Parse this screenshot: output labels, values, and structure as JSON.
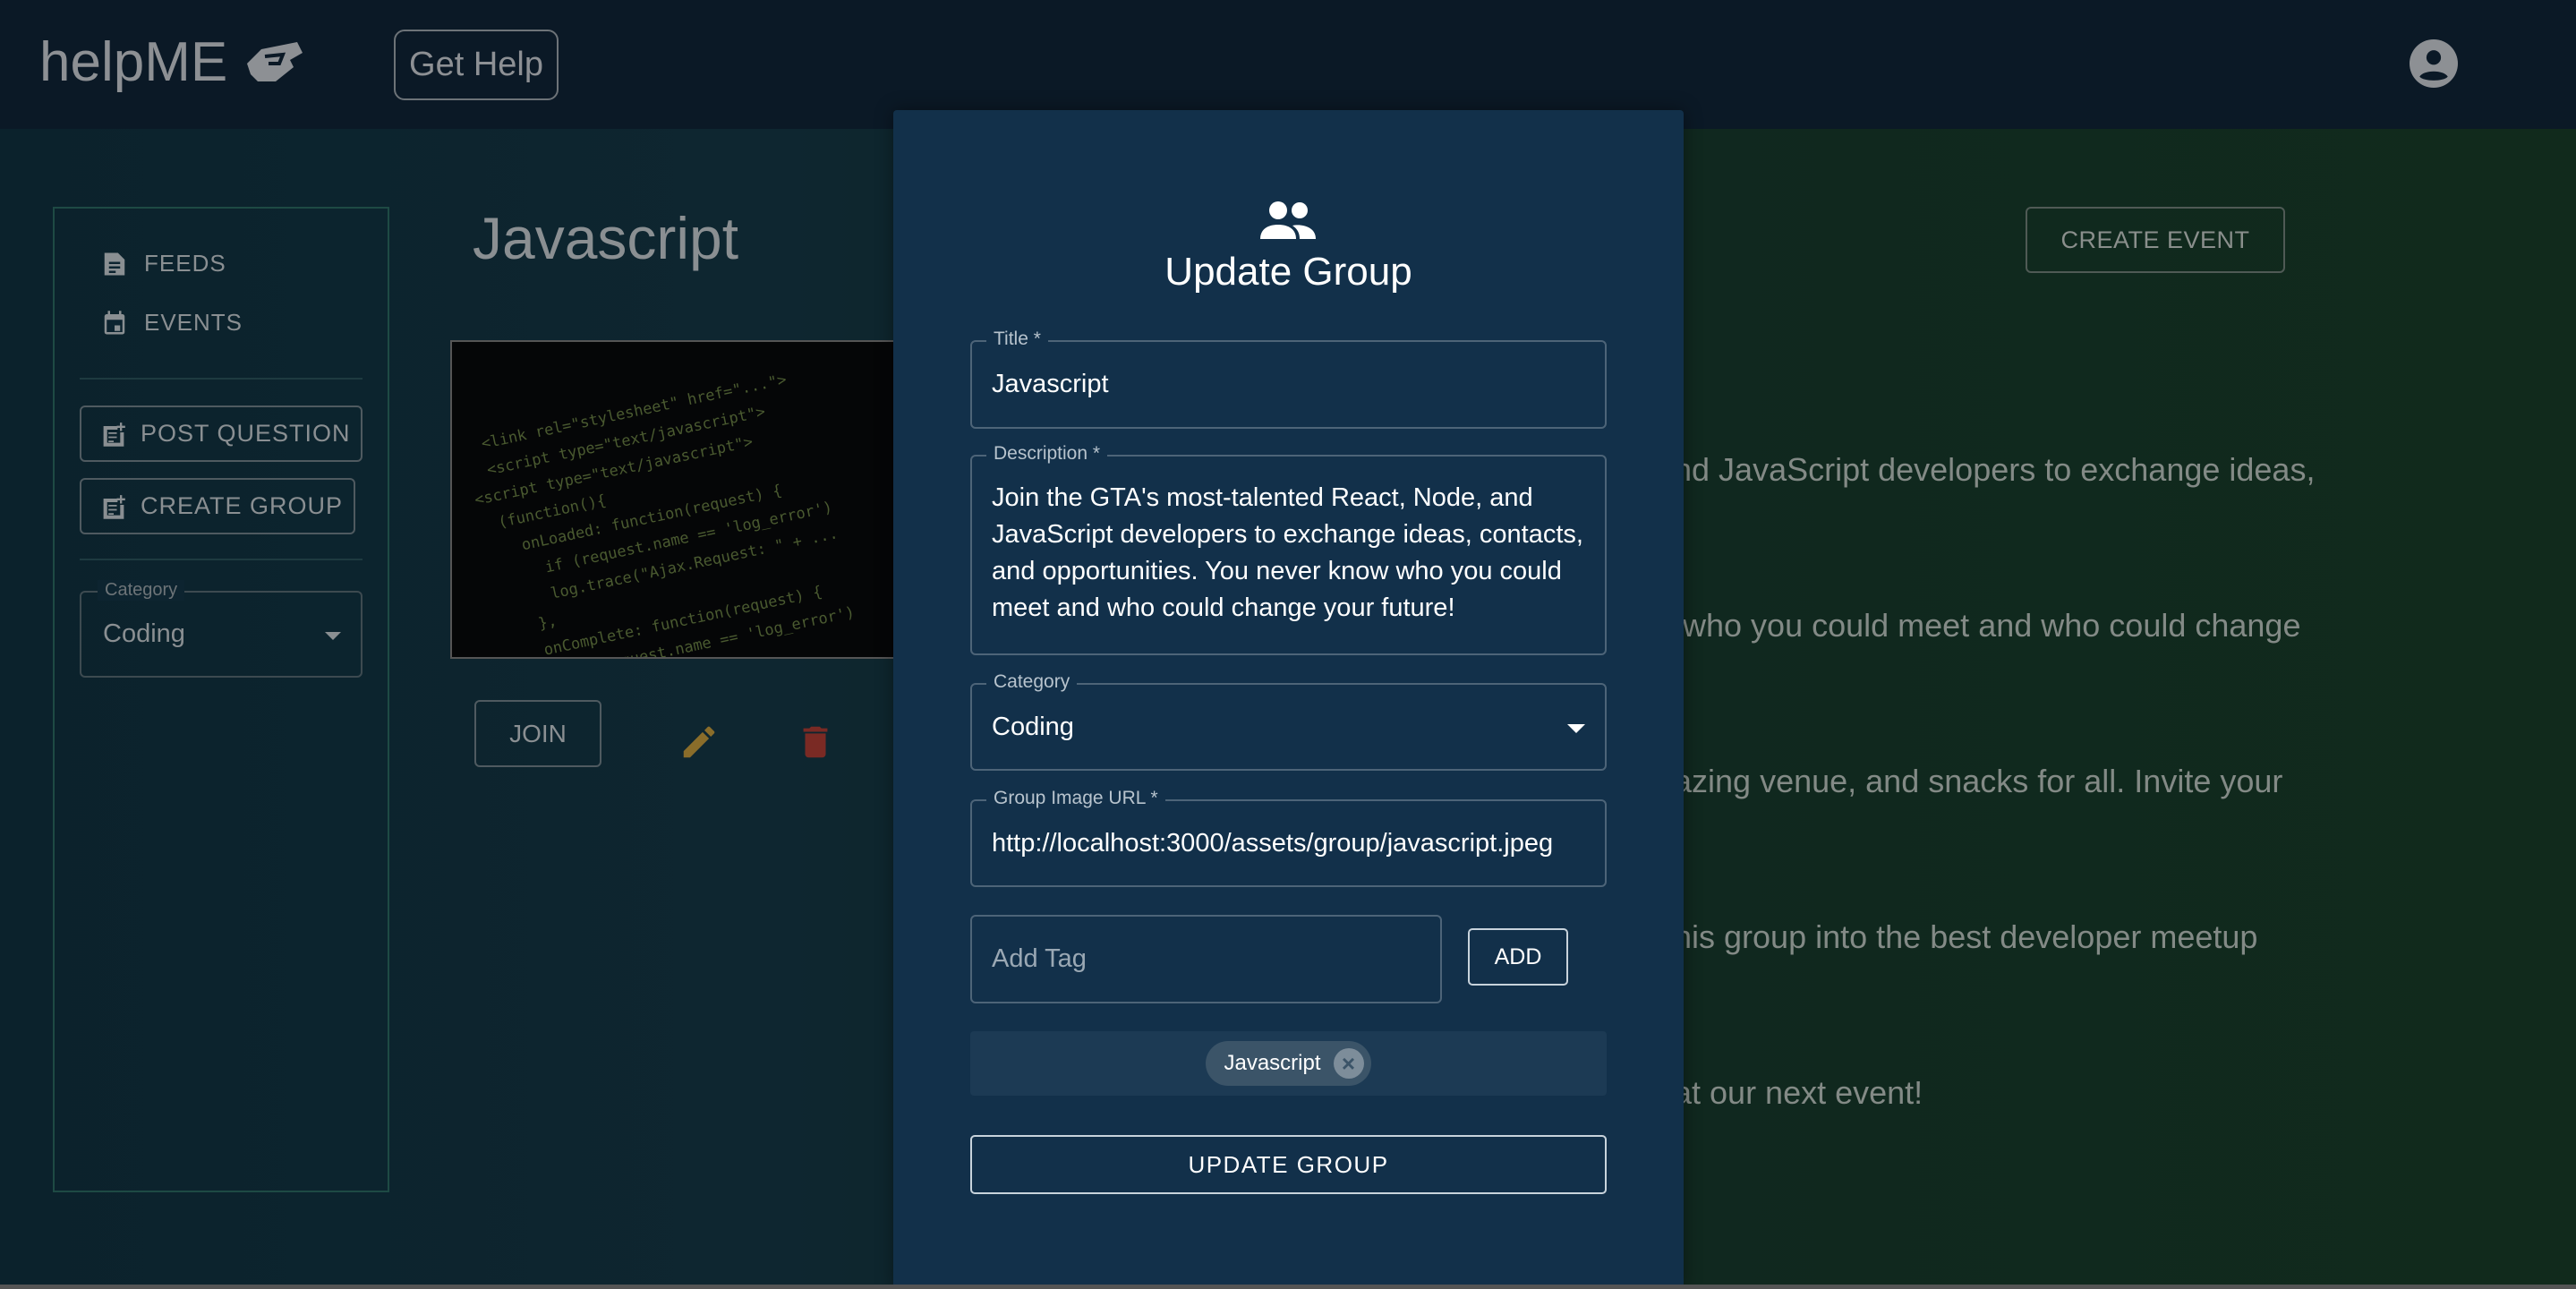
{
  "header": {
    "logo": "helpME",
    "get_help": "Get Help"
  },
  "sidebar": {
    "items": [
      {
        "label": "FEEDS",
        "icon": "article-icon"
      },
      {
        "label": "EVENTS",
        "icon": "event-icon"
      }
    ],
    "post_question": "POST QUESTION",
    "create_group": "CREATE GROUP",
    "category_label": "Category",
    "category_value": "Coding"
  },
  "group": {
    "title": "Javascript",
    "join": "JOIN",
    "create_event": "CREATE EVENT",
    "description_lines": [
      "nd JavaScript developers to exchange ideas,",
      " who you could meet and who could change",
      "azing venue, and snacks for all. Invite your",
      "his group into the best developer meetup",
      "at our next event!"
    ]
  },
  "modal": {
    "title": "Update Group",
    "title_label": "Title *",
    "title_value": "Javascript",
    "description_label": "Description *",
    "description_value": "Join the GTA's most-talented React, Node, and JavaScript developers to exchange ideas, contacts, and opportunities. You never know who you could meet and who could change your future!",
    "category_label": "Category",
    "category_value": "Coding",
    "image_label": "Group Image URL *",
    "image_value": "http://localhost:3000/assets/group/javascript.jpeg",
    "tag_placeholder": "Add Tag",
    "add": "ADD",
    "tags": [
      "Javascript"
    ],
    "submit": "UPDATE GROUP"
  },
  "colors": {
    "modal_bg": "#12304a",
    "header_bg": "#0b1926",
    "pencil": "#8a6d2a",
    "trash": "#7a2a24"
  }
}
